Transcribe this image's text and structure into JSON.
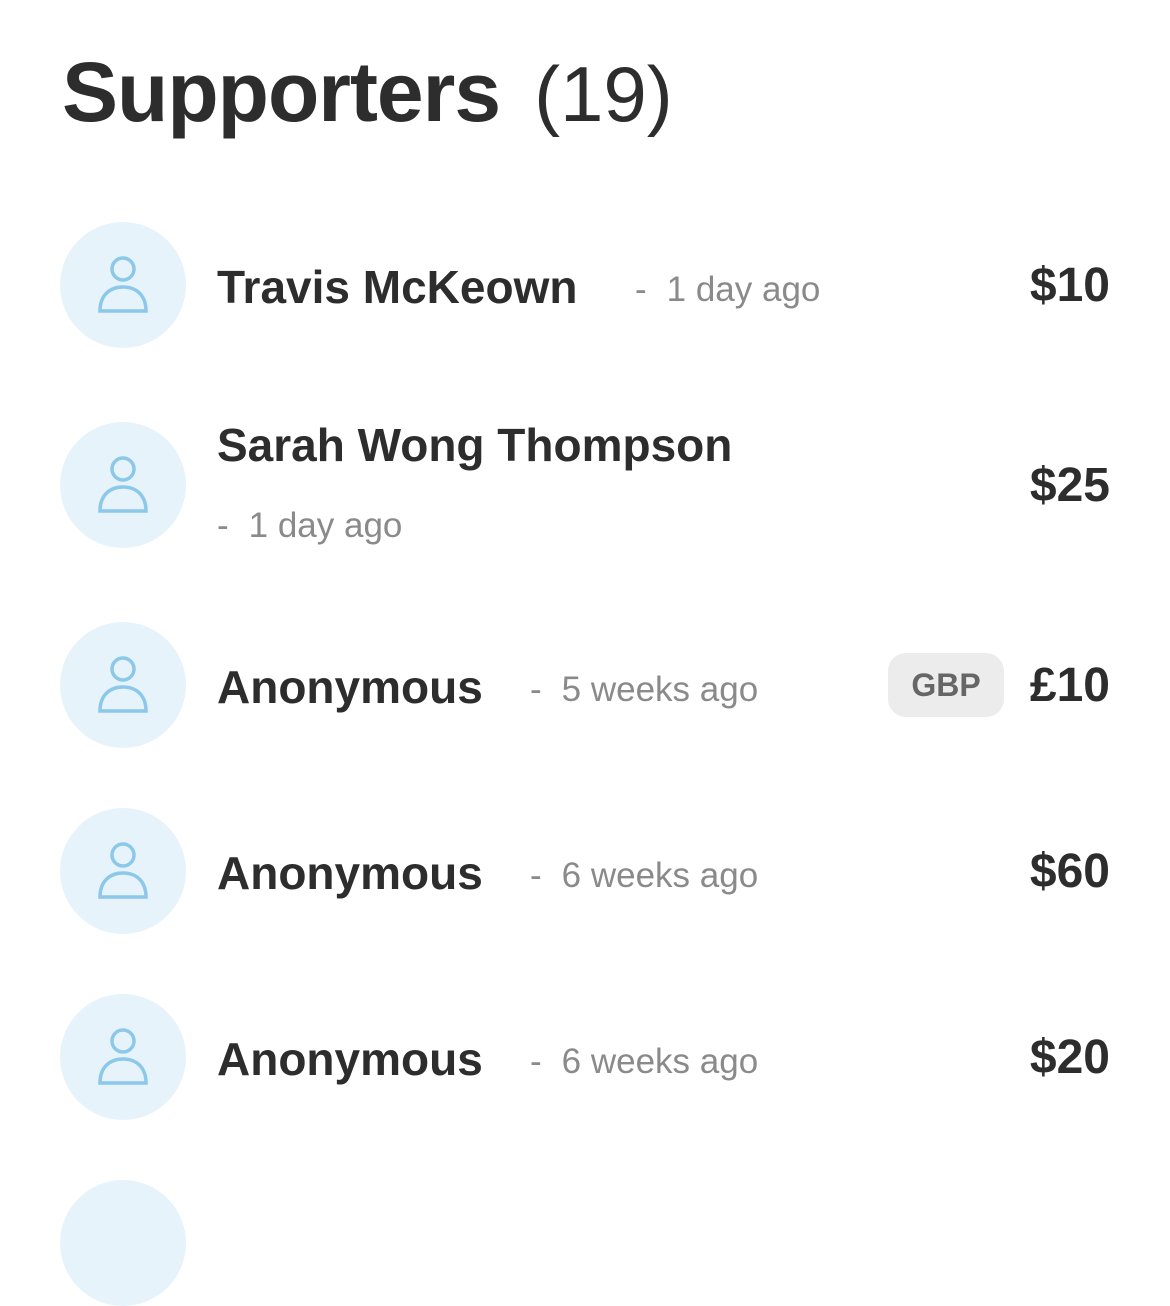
{
  "header": {
    "title": "Supporters",
    "count": "(19)"
  },
  "supporters": [
    {
      "name": "Travis McKeown",
      "separator": "-",
      "time": "1 day ago",
      "amount": "$10",
      "currency_badge": ""
    },
    {
      "name": "Sarah Wong Thompson",
      "separator": "-",
      "time": "1 day ago",
      "amount": "$25",
      "currency_badge": ""
    },
    {
      "name": "Anonymous",
      "separator": "-",
      "time": "5 weeks ago",
      "amount": "£10",
      "currency_badge": "GBP"
    },
    {
      "name": "Anonymous",
      "separator": "-",
      "time": "6 weeks ago",
      "amount": "$60",
      "currency_badge": ""
    },
    {
      "name": "Anonymous",
      "separator": "-",
      "time": "6 weeks ago",
      "amount": "$20",
      "currency_badge": ""
    }
  ],
  "icons": {
    "avatar": "user-icon"
  },
  "colors": {
    "avatar_background": "#e7f3fb",
    "avatar_icon": "#8cc8ea",
    "text_primary": "#2d2d2d",
    "text_secondary": "#8a8a8a",
    "badge_background": "#ececec"
  }
}
